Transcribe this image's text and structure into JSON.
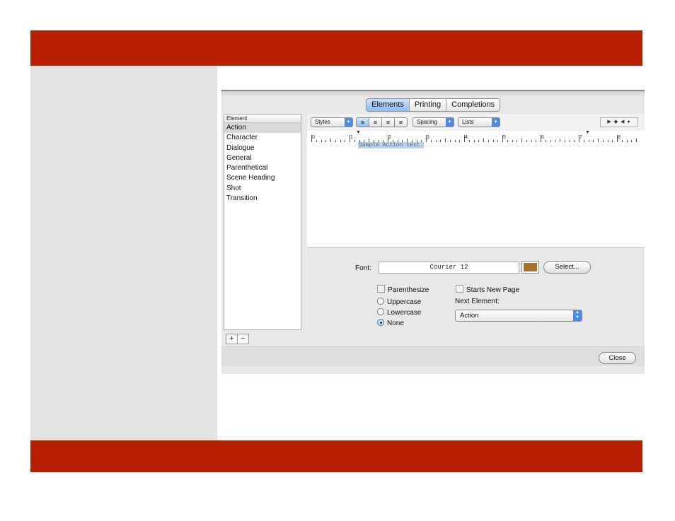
{
  "colors": {
    "banner": "#b81e00",
    "left_panel": "#e3e3e3",
    "font_color_swatch": "#a6712a",
    "accent": "#4e8ae8"
  },
  "tabs": [
    {
      "label": "Elements",
      "active": true
    },
    {
      "label": "Printing",
      "active": false
    },
    {
      "label": "Completions",
      "active": false
    }
  ],
  "element_list": {
    "header": "Element",
    "items": [
      "Action",
      "Character",
      "Dialogue",
      "General",
      "Parenthetical",
      "Scene Heading",
      "Shot",
      "Transition"
    ],
    "selected": "Action",
    "add_label": "+",
    "remove_label": "−"
  },
  "toolbar": {
    "styles_label": "Styles",
    "spacing_label": "Spacing",
    "lists_label": "Lists",
    "alignment_icons": [
      "align-left-icon",
      "align-center-icon",
      "align-right-icon",
      "align-justify-icon"
    ],
    "nav_icons": [
      "play-icon",
      "diamond-icon",
      "back-icon",
      "dot-icon"
    ]
  },
  "ruler": {
    "numbers": [
      "0",
      "1",
      "2",
      "3",
      "4",
      "5",
      "6",
      "7",
      "8"
    ]
  },
  "editor": {
    "sample_text": "Sample Action text."
  },
  "font": {
    "label": "Font:",
    "value": "Courier 12",
    "select_label": "Select..."
  },
  "options": {
    "parenthesize_label": "Parenthesize",
    "parenthesize_checked": false,
    "starts_new_page_label": "Starts New Page",
    "starts_new_page_checked": false,
    "case_options": [
      "Uppercase",
      "Lowercase",
      "None"
    ],
    "case_selected": "None"
  },
  "next_element": {
    "label": "Next Element:",
    "value": "Action"
  },
  "close_label": "Close"
}
